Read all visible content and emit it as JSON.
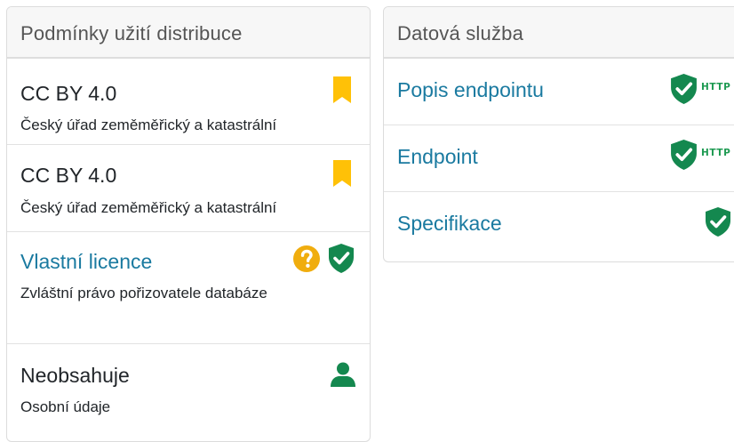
{
  "left_card": {
    "header": "Podmínky užití distribuce",
    "items": [
      {
        "title": "CC BY 4.0",
        "subtitle": "Český úřad zeměměřický a katastrální",
        "icons": [
          "bookmark-icon"
        ]
      },
      {
        "title": "CC BY 4.0",
        "subtitle": "Český úřad zeměměřický a katastrální",
        "icons": [
          "bookmark-icon"
        ]
      },
      {
        "title": "Vlastní licence",
        "subtitle": "Zvláštní právo pořizovatele databáze",
        "icons": [
          "question-circle-icon",
          "shield-check-icon"
        ]
      },
      {
        "title": "Neobsahuje",
        "subtitle": "Osobní údaje",
        "icons": [
          "person-icon"
        ]
      }
    ]
  },
  "right_card": {
    "header": "Datová služba",
    "items": [
      {
        "title": "Popis endpointu",
        "icons": [
          "shield-check-icon"
        ],
        "badge": "HTTP"
      },
      {
        "title": "Endpoint",
        "icons": [
          "shield-check-icon"
        ],
        "badge": "HTTP"
      },
      {
        "title": "Specifikace",
        "icons": [
          "shield-check-icon"
        ]
      }
    ]
  },
  "colors": {
    "link": "#1a7aa0",
    "bookmark": "#ffc107",
    "question": "#f0ad0e",
    "shield": "#14884f",
    "person": "#14884f",
    "http": "#1e9a52"
  }
}
